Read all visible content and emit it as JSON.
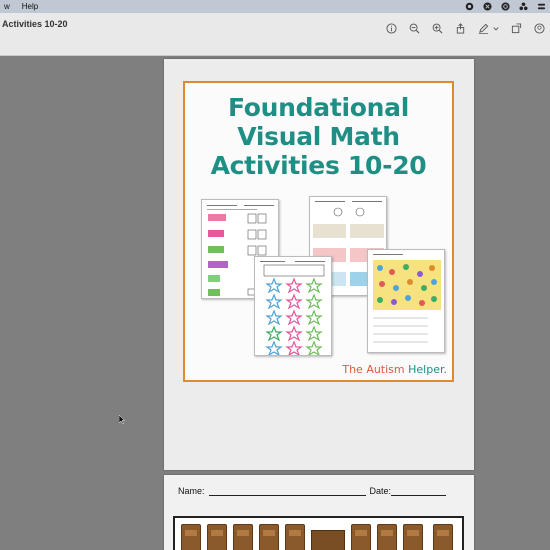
{
  "menubar": {
    "items": [
      "w",
      "Help"
    ]
  },
  "window": {
    "title": "Activities 10-20",
    "toolbar": {
      "tools": [
        "info-icon",
        "zoom-out-icon",
        "zoom-in-icon",
        "share-icon",
        "markup-pen-icon",
        "chevron-down-icon",
        "rotate-icon",
        "search-icon"
      ]
    }
  },
  "document": {
    "cover": {
      "title_line1": "Foundational",
      "title_line2": "Visual Math",
      "title_line3": "Activities 10-20",
      "brand_part1": "The Autism",
      "brand_part2": "Helper."
    },
    "worksheet": {
      "name_label": "Name:",
      "date_label": "Date:"
    }
  },
  "colors": {
    "title_teal": "#1f8f85",
    "border_orange": "#e08a2e",
    "brand_red": "#e0593a"
  }
}
